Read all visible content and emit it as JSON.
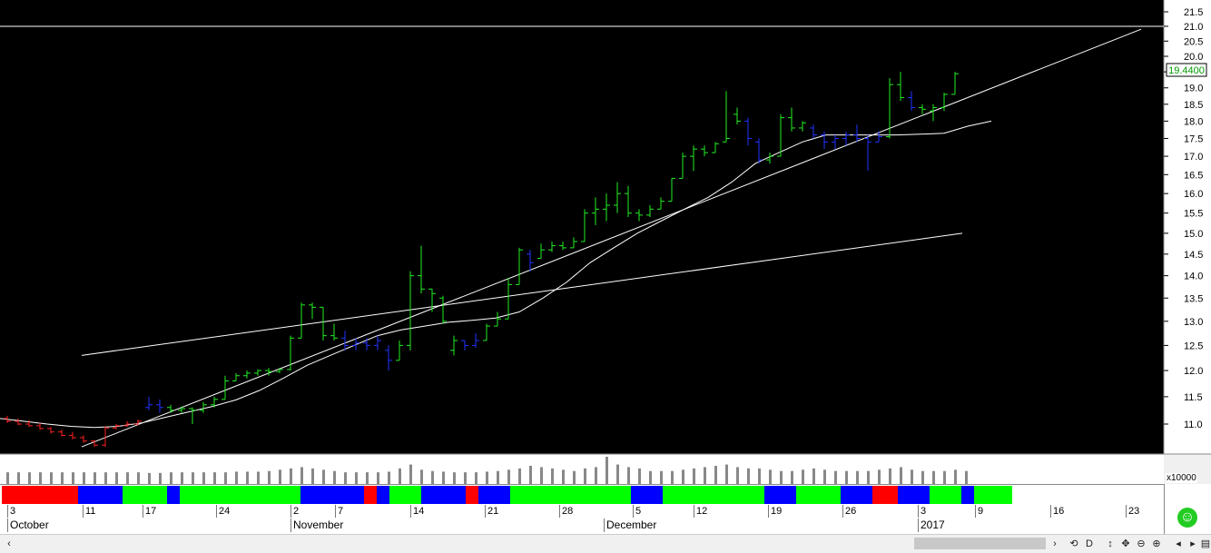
{
  "chart_data": {
    "type": "ohlc",
    "y_axis": {
      "ticks": [
        "21.5",
        "21.0",
        "20.5",
        "20.0",
        "19.5",
        "19.0",
        "18.5",
        "18.0",
        "17.5",
        "17.0",
        "16.5",
        "16.0",
        "15.5",
        "15.0",
        "14.5",
        "14.0",
        "13.5",
        "13.0",
        "12.5",
        "12.0",
        "11.5",
        "11.0"
      ],
      "tick_values": [
        21.5,
        21.0,
        20.5,
        20.0,
        19.5,
        19.0,
        18.5,
        18.0,
        17.5,
        17.0,
        16.5,
        16.0,
        15.5,
        15.0,
        14.5,
        14.0,
        13.5,
        13.0,
        12.5,
        12.0,
        11.5,
        11.0
      ],
      "scale": "log",
      "range": [
        10.5,
        21.8
      ]
    },
    "last_price": "19.4400",
    "horizontal_line": 21.0,
    "bars": [
      {
        "h": 11.15,
        "l": 11.02,
        "o": 11.1,
        "c": 11.05,
        "color": "red"
      },
      {
        "h": 11.1,
        "l": 10.98,
        "o": 11.05,
        "c": 11.0,
        "color": "red"
      },
      {
        "h": 11.07,
        "l": 10.95,
        "o": 11.0,
        "c": 10.97,
        "color": "red"
      },
      {
        "h": 11.02,
        "l": 10.9,
        "o": 10.97,
        "c": 10.92,
        "color": "red"
      },
      {
        "h": 10.95,
        "l": 10.83,
        "o": 10.92,
        "c": 10.86,
        "color": "red"
      },
      {
        "h": 10.9,
        "l": 10.78,
        "o": 10.86,
        "c": 10.8,
        "color": "red"
      },
      {
        "h": 10.86,
        "l": 10.73,
        "o": 10.8,
        "c": 10.76,
        "color": "red"
      },
      {
        "h": 10.8,
        "l": 10.67,
        "o": 10.76,
        "c": 10.7,
        "color": "red"
      },
      {
        "h": 10.72,
        "l": 10.6,
        "o": 10.7,
        "c": 10.63,
        "color": "red"
      },
      {
        "h": 10.96,
        "l": 10.6,
        "o": 10.63,
        "c": 10.93,
        "color": "red"
      },
      {
        "h": 11.0,
        "l": 10.9,
        "o": 10.93,
        "c": 10.97,
        "color": "red"
      },
      {
        "h": 11.05,
        "l": 10.95,
        "o": 10.97,
        "c": 11.0,
        "color": "red"
      },
      {
        "h": 11.08,
        "l": 10.98,
        "o": 11.0,
        "c": 11.05,
        "color": "red"
      },
      {
        "h": 11.5,
        "l": 11.25,
        "o": 11.3,
        "c": 11.35,
        "color": "blue"
      },
      {
        "h": 11.45,
        "l": 11.2,
        "o": 11.35,
        "c": 11.3,
        "color": "blue"
      },
      {
        "h": 11.35,
        "l": 11.2,
        "o": 11.3,
        "c": 11.25,
        "color": "green"
      },
      {
        "h": 11.32,
        "l": 11.2,
        "o": 11.25,
        "c": 11.28,
        "color": "green"
      },
      {
        "h": 11.3,
        "l": 11.0,
        "o": 11.28,
        "c": 11.25,
        "color": "green"
      },
      {
        "h": 11.4,
        "l": 11.2,
        "o": 11.25,
        "c": 11.35,
        "color": "green"
      },
      {
        "h": 11.5,
        "l": 11.3,
        "o": 11.35,
        "c": 11.45,
        "color": "green"
      },
      {
        "h": 11.9,
        "l": 11.45,
        "o": 11.45,
        "c": 11.8,
        "color": "green"
      },
      {
        "h": 11.95,
        "l": 11.8,
        "o": 11.8,
        "c": 11.9,
        "color": "green"
      },
      {
        "h": 12.0,
        "l": 11.85,
        "o": 11.9,
        "c": 11.95,
        "color": "green"
      },
      {
        "h": 12.02,
        "l": 11.9,
        "o": 11.95,
        "c": 12.0,
        "color": "green"
      },
      {
        "h": 12.05,
        "l": 11.9,
        "o": 12.0,
        "c": 11.98,
        "color": "green"
      },
      {
        "h": 12.05,
        "l": 11.95,
        "o": 11.98,
        "c": 12.02,
        "color": "green"
      },
      {
        "h": 12.7,
        "l": 12.0,
        "o": 12.02,
        "c": 12.65,
        "color": "green"
      },
      {
        "h": 13.4,
        "l": 12.65,
        "o": 12.65,
        "c": 13.35,
        "color": "green"
      },
      {
        "h": 13.4,
        "l": 13.05,
        "o": 13.35,
        "c": 13.3,
        "color": "green"
      },
      {
        "h": 13.3,
        "l": 12.6,
        "o": 13.3,
        "c": 12.7,
        "color": "green"
      },
      {
        "h": 12.95,
        "l": 12.6,
        "o": 12.7,
        "c": 12.65,
        "color": "green"
      },
      {
        "h": 12.8,
        "l": 12.4,
        "o": 12.65,
        "c": 12.5,
        "color": "blue"
      },
      {
        "h": 12.65,
        "l": 12.4,
        "o": 12.5,
        "c": 12.55,
        "color": "blue"
      },
      {
        "h": 12.65,
        "l": 12.4,
        "o": 12.55,
        "c": 12.5,
        "color": "blue"
      },
      {
        "h": 12.7,
        "l": 12.4,
        "o": 12.5,
        "c": 12.6,
        "color": "blue"
      },
      {
        "h": 12.5,
        "l": 12.0,
        "o": 12.4,
        "c": 12.2,
        "color": "blue"
      },
      {
        "h": 12.6,
        "l": 12.2,
        "o": 12.2,
        "c": 12.5,
        "color": "green"
      },
      {
        "h": 14.1,
        "l": 12.4,
        "o": 12.5,
        "c": 14.0,
        "color": "green"
      },
      {
        "h": 14.7,
        "l": 13.6,
        "o": 14.0,
        "c": 13.7,
        "color": "green"
      },
      {
        "h": 13.7,
        "l": 13.2,
        "o": 13.7,
        "c": 13.6,
        "color": "green"
      },
      {
        "h": 13.55,
        "l": 12.95,
        "o": 13.5,
        "c": 13.0,
        "color": "green"
      },
      {
        "h": 12.7,
        "l": 12.3,
        "o": 12.4,
        "c": 12.6,
        "color": "green"
      },
      {
        "h": 12.6,
        "l": 12.4,
        "o": 12.6,
        "c": 12.5,
        "color": "blue"
      },
      {
        "h": 12.75,
        "l": 12.45,
        "o": 12.5,
        "c": 12.6,
        "color": "blue"
      },
      {
        "h": 12.95,
        "l": 12.6,
        "o": 12.6,
        "c": 12.9,
        "color": "green"
      },
      {
        "h": 13.2,
        "l": 12.9,
        "o": 12.9,
        "c": 13.05,
        "color": "green"
      },
      {
        "h": 13.95,
        "l": 13.05,
        "o": 13.05,
        "c": 13.8,
        "color": "green"
      },
      {
        "h": 14.65,
        "l": 13.8,
        "o": 13.8,
        "c": 14.6,
        "color": "green"
      },
      {
        "h": 14.6,
        "l": 14.1,
        "o": 14.5,
        "c": 14.3,
        "color": "blue"
      },
      {
        "h": 14.75,
        "l": 14.4,
        "o": 14.4,
        "c": 14.6,
        "color": "green"
      },
      {
        "h": 14.8,
        "l": 14.55,
        "o": 14.6,
        "c": 14.7,
        "color": "green"
      },
      {
        "h": 14.8,
        "l": 14.6,
        "o": 14.7,
        "c": 14.65,
        "color": "green"
      },
      {
        "h": 14.9,
        "l": 14.65,
        "o": 14.65,
        "c": 14.8,
        "color": "green"
      },
      {
        "h": 15.6,
        "l": 14.8,
        "o": 14.8,
        "c": 15.5,
        "color": "green"
      },
      {
        "h": 15.9,
        "l": 15.2,
        "o": 15.5,
        "c": 15.6,
        "color": "green"
      },
      {
        "h": 16.0,
        "l": 15.3,
        "o": 15.6,
        "c": 15.7,
        "color": "green"
      },
      {
        "h": 16.3,
        "l": 15.5,
        "o": 15.7,
        "c": 16.0,
        "color": "green"
      },
      {
        "h": 16.2,
        "l": 15.4,
        "o": 16.0,
        "c": 15.5,
        "color": "green"
      },
      {
        "h": 15.6,
        "l": 15.3,
        "o": 15.5,
        "c": 15.45,
        "color": "green"
      },
      {
        "h": 15.7,
        "l": 15.4,
        "o": 15.45,
        "c": 15.6,
        "color": "green"
      },
      {
        "h": 15.9,
        "l": 15.6,
        "o": 15.6,
        "c": 15.8,
        "color": "green"
      },
      {
        "h": 16.4,
        "l": 15.8,
        "o": 15.8,
        "c": 16.4,
        "color": "green"
      },
      {
        "h": 17.1,
        "l": 16.4,
        "o": 16.4,
        "c": 17.0,
        "color": "green"
      },
      {
        "h": 17.3,
        "l": 16.6,
        "o": 17.0,
        "c": 17.2,
        "color": "green"
      },
      {
        "h": 17.3,
        "l": 17.0,
        "o": 17.2,
        "c": 17.1,
        "color": "green"
      },
      {
        "h": 17.4,
        "l": 17.1,
        "o": 17.1,
        "c": 17.35,
        "color": "green"
      },
      {
        "h": 18.9,
        "l": 17.4,
        "o": 17.4,
        "c": 17.5,
        "color": "green"
      },
      {
        "h": 18.4,
        "l": 17.9,
        "o": 18.2,
        "c": 18.0,
        "color": "green"
      },
      {
        "h": 18.1,
        "l": 17.3,
        "o": 18.0,
        "c": 17.5,
        "color": "blue"
      },
      {
        "h": 17.5,
        "l": 16.8,
        "o": 17.4,
        "c": 16.9,
        "color": "blue"
      },
      {
        "h": 17.1,
        "l": 16.8,
        "o": 16.9,
        "c": 17.0,
        "color": "green"
      },
      {
        "h": 18.2,
        "l": 17.0,
        "o": 17.0,
        "c": 18.1,
        "color": "green"
      },
      {
        "h": 18.4,
        "l": 17.7,
        "o": 18.1,
        "c": 17.8,
        "color": "green"
      },
      {
        "h": 18.0,
        "l": 17.7,
        "o": 17.8,
        "c": 17.95,
        "color": "green"
      },
      {
        "h": 17.9,
        "l": 17.5,
        "o": 17.8,
        "c": 17.6,
        "color": "blue"
      },
      {
        "h": 17.7,
        "l": 17.2,
        "o": 17.6,
        "c": 17.4,
        "color": "blue"
      },
      {
        "h": 17.6,
        "l": 17.2,
        "o": 17.4,
        "c": 17.5,
        "color": "blue"
      },
      {
        "h": 17.7,
        "l": 17.3,
        "o": 17.5,
        "c": 17.6,
        "color": "blue"
      },
      {
        "h": 17.9,
        "l": 17.4,
        "o": 17.6,
        "c": 17.5,
        "color": "blue"
      },
      {
        "h": 17.6,
        "l": 16.6,
        "o": 17.5,
        "c": 17.4,
        "color": "blue"
      },
      {
        "h": 17.7,
        "l": 17.4,
        "o": 17.4,
        "c": 17.55,
        "color": "blue"
      },
      {
        "h": 19.3,
        "l": 17.5,
        "o": 17.55,
        "c": 19.1,
        "color": "green"
      },
      {
        "h": 19.5,
        "l": 18.6,
        "o": 19.1,
        "c": 18.7,
        "color": "green"
      },
      {
        "h": 18.9,
        "l": 18.3,
        "o": 18.7,
        "c": 18.4,
        "color": "blue"
      },
      {
        "h": 18.5,
        "l": 18.2,
        "o": 18.4,
        "c": 18.35,
        "color": "green"
      },
      {
        "h": 18.5,
        "l": 18.0,
        "o": 18.3,
        "c": 18.4,
        "color": "green"
      },
      {
        "h": 18.85,
        "l": 18.3,
        "o": 18.4,
        "c": 18.8,
        "color": "green"
      },
      {
        "h": 19.5,
        "l": 18.8,
        "o": 18.8,
        "c": 19.44,
        "color": "green"
      }
    ],
    "moving_average": [
      11.1,
      11.05,
      11.0,
      10.96,
      10.94,
      10.96,
      11.02,
      11.12,
      11.22,
      11.32,
      11.44,
      11.62,
      11.85,
      12.1,
      12.3,
      12.5,
      12.7,
      12.82,
      12.9,
      12.98,
      13.02,
      13.07,
      13.2,
      13.5,
      13.85,
      14.3,
      14.65,
      15.0,
      15.3,
      15.6,
      15.9,
      16.3,
      16.8,
      17.1,
      17.4,
      17.6,
      17.6,
      17.6,
      17.6,
      17.62,
      17.65,
      17.85,
      18.0
    ],
    "trendlines": [
      {
        "from": [
          10.6,
          0
        ],
        "to": [
          20.9,
          1
        ]
      },
      {
        "from": [
          12.3,
          0
        ],
        "to": [
          15.0,
          1
        ]
      }
    ],
    "volume": [
      18,
      18,
      18,
      18,
      18,
      18,
      18,
      18,
      18,
      18,
      18,
      18,
      18,
      17,
      17,
      18,
      18,
      18,
      18,
      18,
      18,
      19,
      19,
      19,
      20,
      22,
      24,
      26,
      24,
      22,
      20,
      18,
      18,
      18,
      18,
      19,
      24,
      30,
      22,
      20,
      19,
      18,
      18,
      18,
      19,
      20,
      22,
      24,
      28,
      26,
      24,
      22,
      20,
      24,
      26,
      42,
      30,
      26,
      24,
      20,
      20,
      20,
      22,
      24,
      26,
      28,
      30,
      26,
      24,
      24,
      22,
      20,
      20,
      22,
      24,
      22,
      20,
      20,
      20,
      20,
      22,
      24,
      26,
      22,
      20,
      20,
      20,
      22,
      20
    ],
    "volume_scale": "x10000",
    "color_segments": [
      {
        "color": "#ff0000",
        "from": 0,
        "to": 12
      },
      {
        "color": "#0000ff",
        "from": 12,
        "to": 19
      },
      {
        "color": "#00ff00",
        "from": 19,
        "to": 26
      },
      {
        "color": "#0000ff",
        "from": 26,
        "to": 28
      },
      {
        "color": "#00ff00",
        "from": 28,
        "to": 47
      },
      {
        "color": "#0000ff",
        "from": 47,
        "to": 57
      },
      {
        "color": "#ff0000",
        "from": 57,
        "to": 59
      },
      {
        "color": "#0000ff",
        "from": 59,
        "to": 61
      },
      {
        "color": "#00ff00",
        "from": 61,
        "to": 66
      },
      {
        "color": "#0000ff",
        "from": 66,
        "to": 73
      },
      {
        "color": "#ff0000",
        "from": 73,
        "to": 75
      },
      {
        "color": "#0000ff",
        "from": 75,
        "to": 80
      },
      {
        "color": "#00ff00",
        "from": 80,
        "to": 99
      },
      {
        "color": "#0000ff",
        "from": 99,
        "to": 104
      },
      {
        "color": "#00ff00",
        "from": 104,
        "to": 120
      },
      {
        "color": "#0000ff",
        "from": 120,
        "to": 125
      },
      {
        "color": "#00ff00",
        "from": 125,
        "to": 132
      },
      {
        "color": "#0000ff",
        "from": 132,
        "to": 137
      },
      {
        "color": "#ff0000",
        "from": 137,
        "to": 141
      },
      {
        "color": "#0000ff",
        "from": 141,
        "to": 146
      },
      {
        "color": "#00ff00",
        "from": 146,
        "to": 151
      },
      {
        "color": "#0000ff",
        "from": 151,
        "to": 153
      },
      {
        "color": "#00ff00",
        "from": 153,
        "to": 159
      }
    ],
    "day_ticks": [
      "3",
      "11",
      "17",
      "24",
      "2",
      "7",
      "14",
      "21",
      "28",
      "5",
      "12",
      "19",
      "26",
      "3",
      "9",
      "16",
      "23"
    ],
    "month_ticks": [
      "October",
      "November",
      "December",
      "2017"
    ]
  }
}
